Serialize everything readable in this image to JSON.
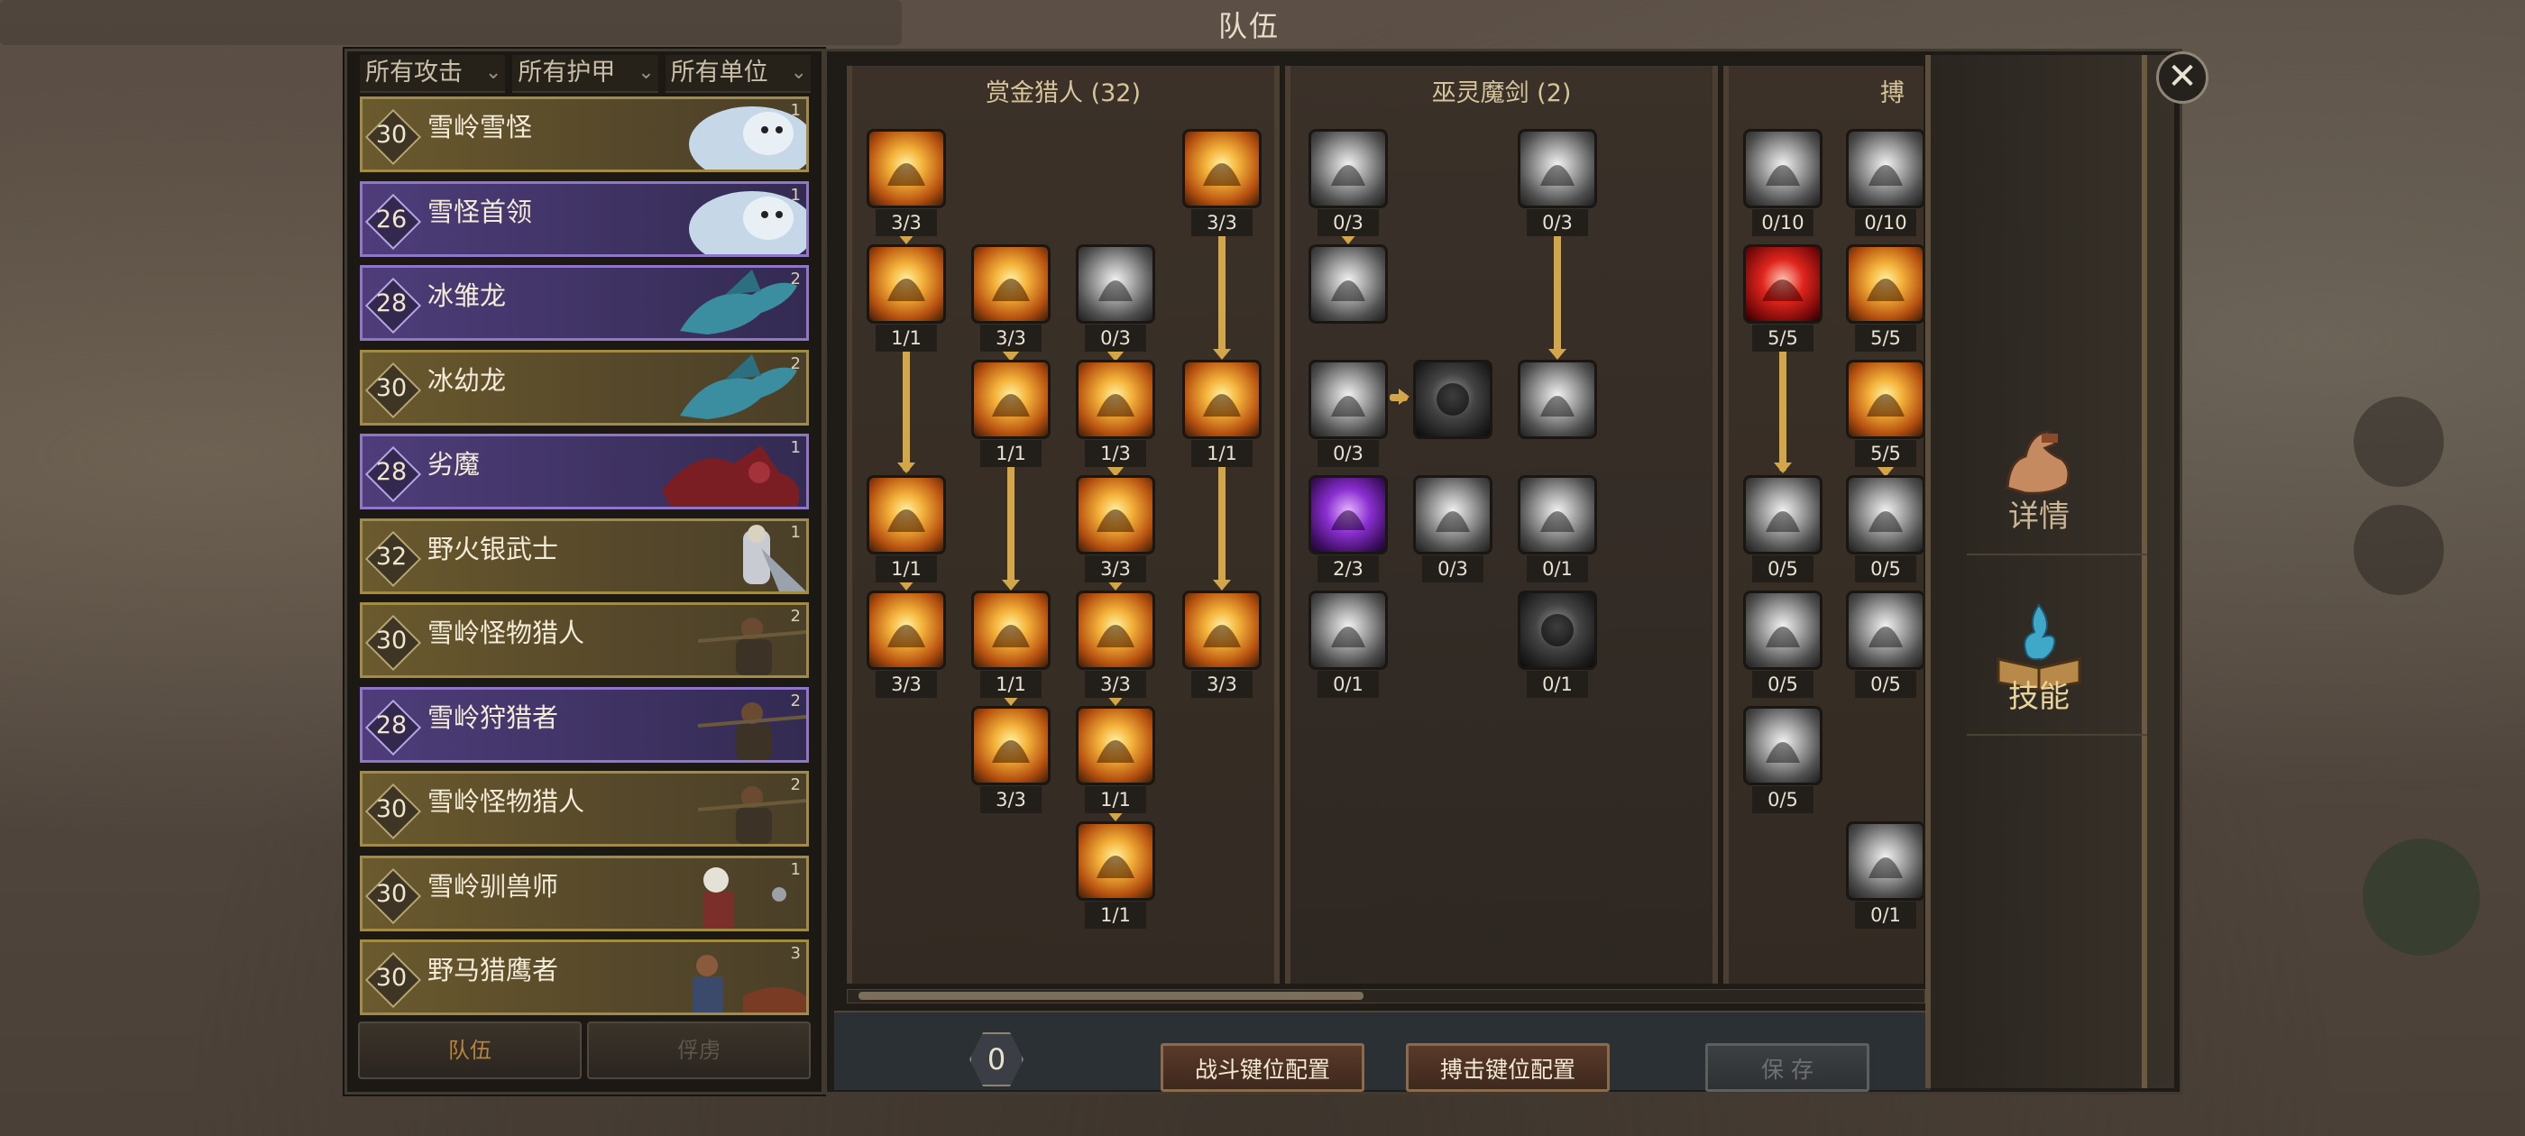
{
  "window": {
    "title": "队伍",
    "close_label": "✕"
  },
  "filters": [
    {
      "label": "所有攻击"
    },
    {
      "label": "所有护甲"
    },
    {
      "label": "所有单位"
    }
  ],
  "roster": [
    {
      "level": "30",
      "name": "雪岭雪怪",
      "count": "1",
      "color": "gold",
      "portrait": "yeti"
    },
    {
      "level": "26",
      "name": "雪怪首领",
      "count": "1",
      "color": "purple",
      "portrait": "yeti"
    },
    {
      "level": "28",
      "name": "冰雏龙",
      "count": "2",
      "color": "purple",
      "portrait": "drake"
    },
    {
      "level": "30",
      "name": "冰幼龙",
      "count": "2",
      "color": "gold",
      "portrait": "drake"
    },
    {
      "level": "28",
      "name": "劣魔",
      "count": "1",
      "color": "purple",
      "portrait": "imp"
    },
    {
      "level": "32",
      "name": "野火银武士",
      "count": "1",
      "color": "gold",
      "portrait": "knight"
    },
    {
      "level": "30",
      "name": "雪岭怪物猎人",
      "count": "2",
      "color": "gold",
      "portrait": "hunter"
    },
    {
      "level": "28",
      "name": "雪岭狩猎者",
      "count": "2",
      "color": "purple",
      "portrait": "hunter"
    },
    {
      "level": "30",
      "name": "雪岭怪物猎人",
      "count": "2",
      "color": "gold",
      "portrait": "hunter"
    },
    {
      "level": "30",
      "name": "雪岭驯兽师",
      "count": "1",
      "color": "gold",
      "portrait": "tamer"
    },
    {
      "level": "30",
      "name": "野马猎鹰者",
      "count": "3",
      "color": "gold",
      "portrait": "falconer"
    }
  ],
  "bottom_tabs": [
    {
      "label": "队伍",
      "active": true
    },
    {
      "label": "俘虏",
      "active": false
    }
  ],
  "trees": [
    {
      "title": "赏金猎人 (32)",
      "skills": [
        {
          "rank": "3/3",
          "style": "gold",
          "icon": "fire-dash-icon"
        },
        {
          "rank": "3/3",
          "style": "gold",
          "icon": "fire-grab-icon"
        },
        {
          "rank": "1/1",
          "style": "gold",
          "icon": "golden-eye-icon"
        },
        {
          "rank": "3/3",
          "style": "gold",
          "icon": "sunburst-icon"
        },
        {
          "rank": "0/3",
          "style": "grey",
          "icon": "wing-slash-icon"
        },
        {
          "rank": "1/1",
          "style": "gold",
          "icon": "fire-ring-icon"
        },
        {
          "rank": "1/3",
          "style": "gold",
          "icon": "crossed-swords-icon"
        },
        {
          "rank": "1/1",
          "style": "gold",
          "icon": "flame-pillar-icon"
        },
        {
          "rank": "1/1",
          "style": "gold",
          "icon": "fire-burst-icon"
        },
        {
          "rank": "3/3",
          "style": "gold",
          "icon": "shield-lance-icon"
        },
        {
          "rank": "3/3",
          "style": "gold",
          "icon": "target-icon"
        },
        {
          "rank": "1/1",
          "style": "gold",
          "icon": "purple-orb-icon"
        },
        {
          "rank": "3/3",
          "style": "gold",
          "icon": "blade-icon"
        },
        {
          "rank": "3/3",
          "style": "gold",
          "icon": "skull-icon"
        },
        {
          "rank": "3/3",
          "style": "gold",
          "icon": "imp-icon"
        },
        {
          "rank": "1/1",
          "style": "gold",
          "icon": "war-cry-icon"
        },
        {
          "rank": "1/1",
          "style": "gold",
          "icon": "golden-blade-icon"
        }
      ]
    },
    {
      "title": "巫灵魔剑 (2)",
      "skills": [
        {
          "rank": "0/3",
          "style": "grey",
          "icon": "claw-slash-icon"
        },
        {
          "rank": "0/3",
          "style": "grey",
          "icon": "wind-slash-icon"
        },
        {
          "rank": "",
          "style": "grey",
          "icon": "duel-icon"
        },
        {
          "rank": "0/3",
          "style": "grey",
          "icon": "spin-slash-icon"
        },
        {
          "rank": "",
          "style": "dark",
          "icon": "demon-icon"
        },
        {
          "rank": "",
          "style": "grey",
          "icon": "feather-slash-icon"
        },
        {
          "rank": "2/3",
          "style": "purp",
          "icon": "void-dragon-icon"
        },
        {
          "rank": "0/3",
          "style": "grey",
          "icon": "sword-icon"
        },
        {
          "rank": "0/1",
          "style": "grey",
          "icon": "hooded-icon"
        },
        {
          "rank": "0/1",
          "style": "grey",
          "icon": "scythe-icon"
        },
        {
          "rank": "0/1",
          "style": "dark",
          "icon": "hooded-shadow-icon"
        }
      ]
    },
    {
      "title": "搏",
      "skills": [
        {
          "rank": "0/10",
          "style": "grey",
          "icon": "fist-icon"
        },
        {
          "rank": "0/10",
          "style": "grey",
          "icon": "fist-icon"
        },
        {
          "rank": "5/5",
          "style": "red",
          "icon": "red-claw-icon"
        },
        {
          "rank": "5/5",
          "style": "gold",
          "icon": "purple-eye-icon"
        },
        {
          "rank": "5/5",
          "style": "gold",
          "icon": "fire-fist-icon"
        },
        {
          "rank": "0/5",
          "style": "grey",
          "icon": "punch-icon"
        },
        {
          "rank": "0/5",
          "style": "grey",
          "icon": "burst-icon"
        },
        {
          "rank": "0/5",
          "style": "grey",
          "icon": "eye-fist-icon"
        },
        {
          "rank": "0/5",
          "style": "grey",
          "icon": "glove-icon"
        },
        {
          "rank": "0/5",
          "style": "grey",
          "icon": "crush-icon"
        },
        {
          "rank": "0/1",
          "style": "grey",
          "icon": "skull-fist-icon"
        }
      ]
    }
  ],
  "footer": {
    "points": "0",
    "combat_keys_label": "战斗键位配置",
    "brawl_keys_label": "搏击键位配置",
    "save_label": "保 存"
  },
  "side_tabs": [
    {
      "label": "详情",
      "icon": "flexed-arm-icon",
      "active": false
    },
    {
      "label": "技能",
      "icon": "skill-book-icon",
      "active": true
    }
  ],
  "colors": {
    "accent_gold": "#d4a64a",
    "purple_row": "#8f76c8",
    "gold_row": "#a28b44"
  }
}
